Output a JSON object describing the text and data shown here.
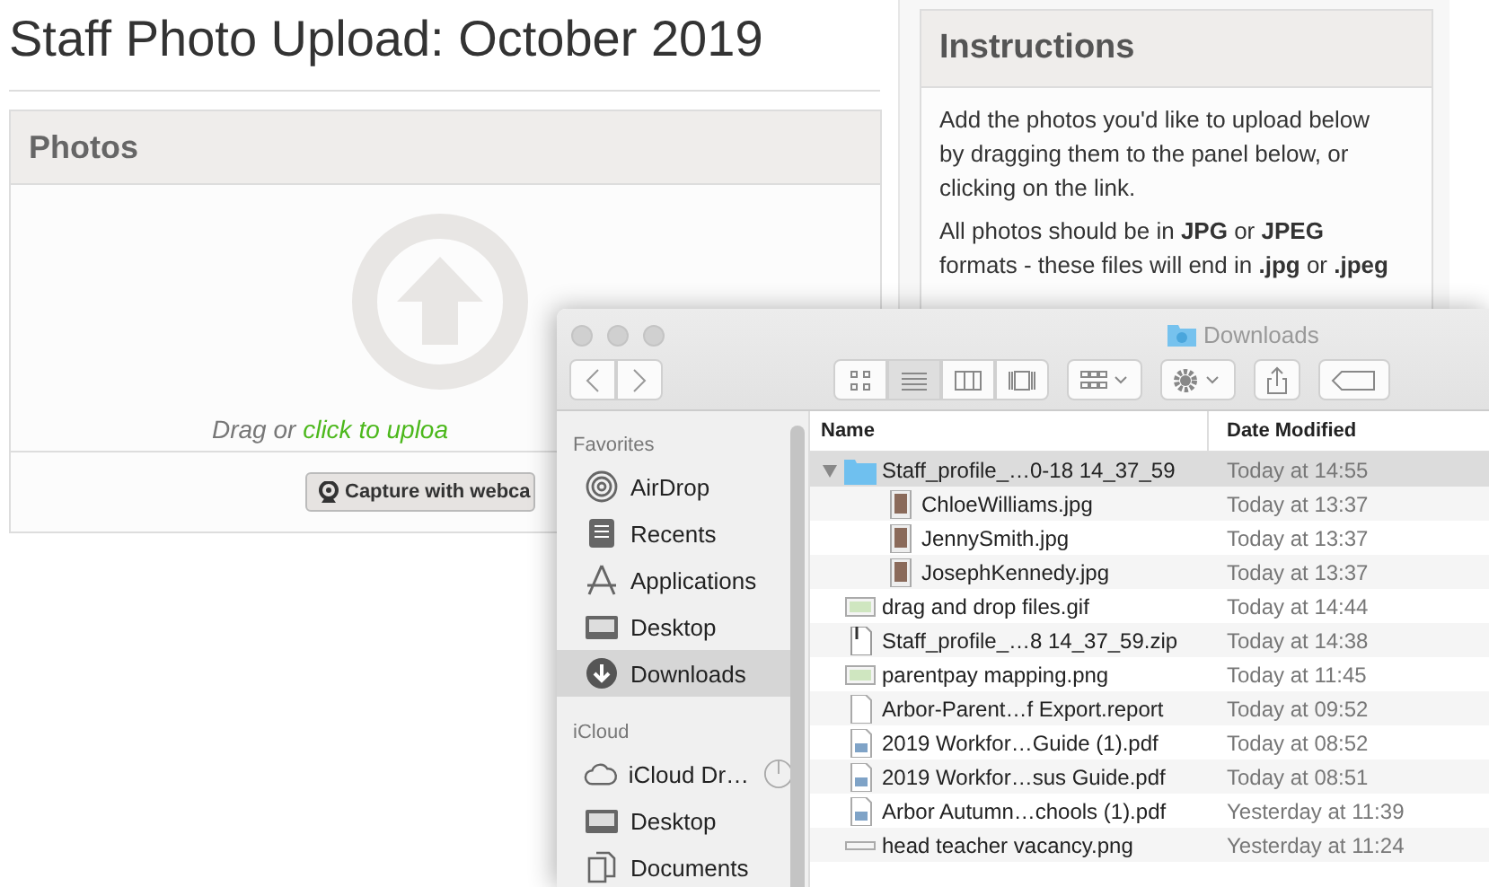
{
  "page_title": "Staff Photo Upload: October 2019",
  "photos_panel": {
    "title": "Photos",
    "drop_hint": "Drag or ",
    "upload_link": "click to uploa",
    "webcam_button": "Capture with webca"
  },
  "instructions": {
    "title": "Instructions",
    "paragraphs": [
      "Add the photos you'd like to upload below by dragging them to the panel below, or clicking on the link.",
      "All photos should be in **JPG** or **JPEG** formats - these files will end in **.jpg** or **.jpeg**"
    ]
  },
  "finder": {
    "title": "Downloads",
    "view_modes": [
      {
        "kind": "icons",
        "selected": false
      },
      {
        "kind": "list",
        "selected": true
      },
      {
        "kind": "columns",
        "selected": false
      },
      {
        "kind": "gallery",
        "selected": false
      }
    ],
    "sidebar": [
      {
        "heading": "Favorites",
        "items": [
          {
            "label": "AirDrop",
            "kind": "airdrop",
            "selected": false
          },
          {
            "label": "Recents",
            "kind": "recents",
            "selected": false
          },
          {
            "label": "Applications",
            "kind": "apps",
            "selected": false
          },
          {
            "label": "Desktop",
            "kind": "desktop",
            "selected": false
          },
          {
            "label": "Downloads",
            "kind": "downloads",
            "selected": true
          }
        ]
      },
      {
        "heading": "iCloud",
        "items": [
          {
            "label": "iCloud Dr…",
            "kind": "cloud",
            "selected": false
          },
          {
            "label": "Desktop",
            "kind": "desktop",
            "selected": false
          },
          {
            "label": "Documents",
            "kind": "documents",
            "selected": false
          }
        ]
      }
    ],
    "columns": [
      "Name",
      "Date Modified"
    ],
    "files": [
      {
        "name": "Staff_profile_…0-18 14_37_59",
        "date": "Today at 14:55",
        "kind": "folder",
        "selected": true,
        "expanded": true,
        "children": [
          {
            "name": "ChloeWilliams.jpg",
            "date": "Today at 13:37",
            "kind": "photo",
            "selected": false
          },
          {
            "name": "JennySmith.jpg",
            "date": "Today at 13:37",
            "kind": "photo",
            "selected": false
          },
          {
            "name": "JosephKennedy.jpg",
            "date": "Today at 13:37",
            "kind": "photo",
            "selected": false
          }
        ]
      },
      {
        "name": "drag and drop files.gif",
        "date": "Today at 14:44",
        "kind": "image",
        "selected": false
      },
      {
        "name": "Staff_profile_…8 14_37_59.zip",
        "date": "Today at 14:38",
        "kind": "zip",
        "selected": false
      },
      {
        "name": "parentpay mapping.png",
        "date": "Today at 11:45",
        "kind": "image",
        "selected": false
      },
      {
        "name": "Arbor-Parent…f Export.report",
        "date": "Today at 09:52",
        "kind": "document",
        "selected": false
      },
      {
        "name": "2019 Workfor…Guide (1).pdf",
        "date": "Today at 08:52",
        "kind": "pdf",
        "selected": false
      },
      {
        "name": "2019 Workfor…sus Guide.pdf",
        "date": "Today at 08:51",
        "kind": "pdf",
        "selected": false
      },
      {
        "name": "Arbor Autumn…chools (1).pdf",
        "date": "Yesterday at 11:39",
        "kind": "pdf",
        "selected": false
      },
      {
        "name": "head teacher vacancy.png",
        "date": "Yesterday at 11:24",
        "kind": "strip",
        "selected": false
      }
    ]
  }
}
